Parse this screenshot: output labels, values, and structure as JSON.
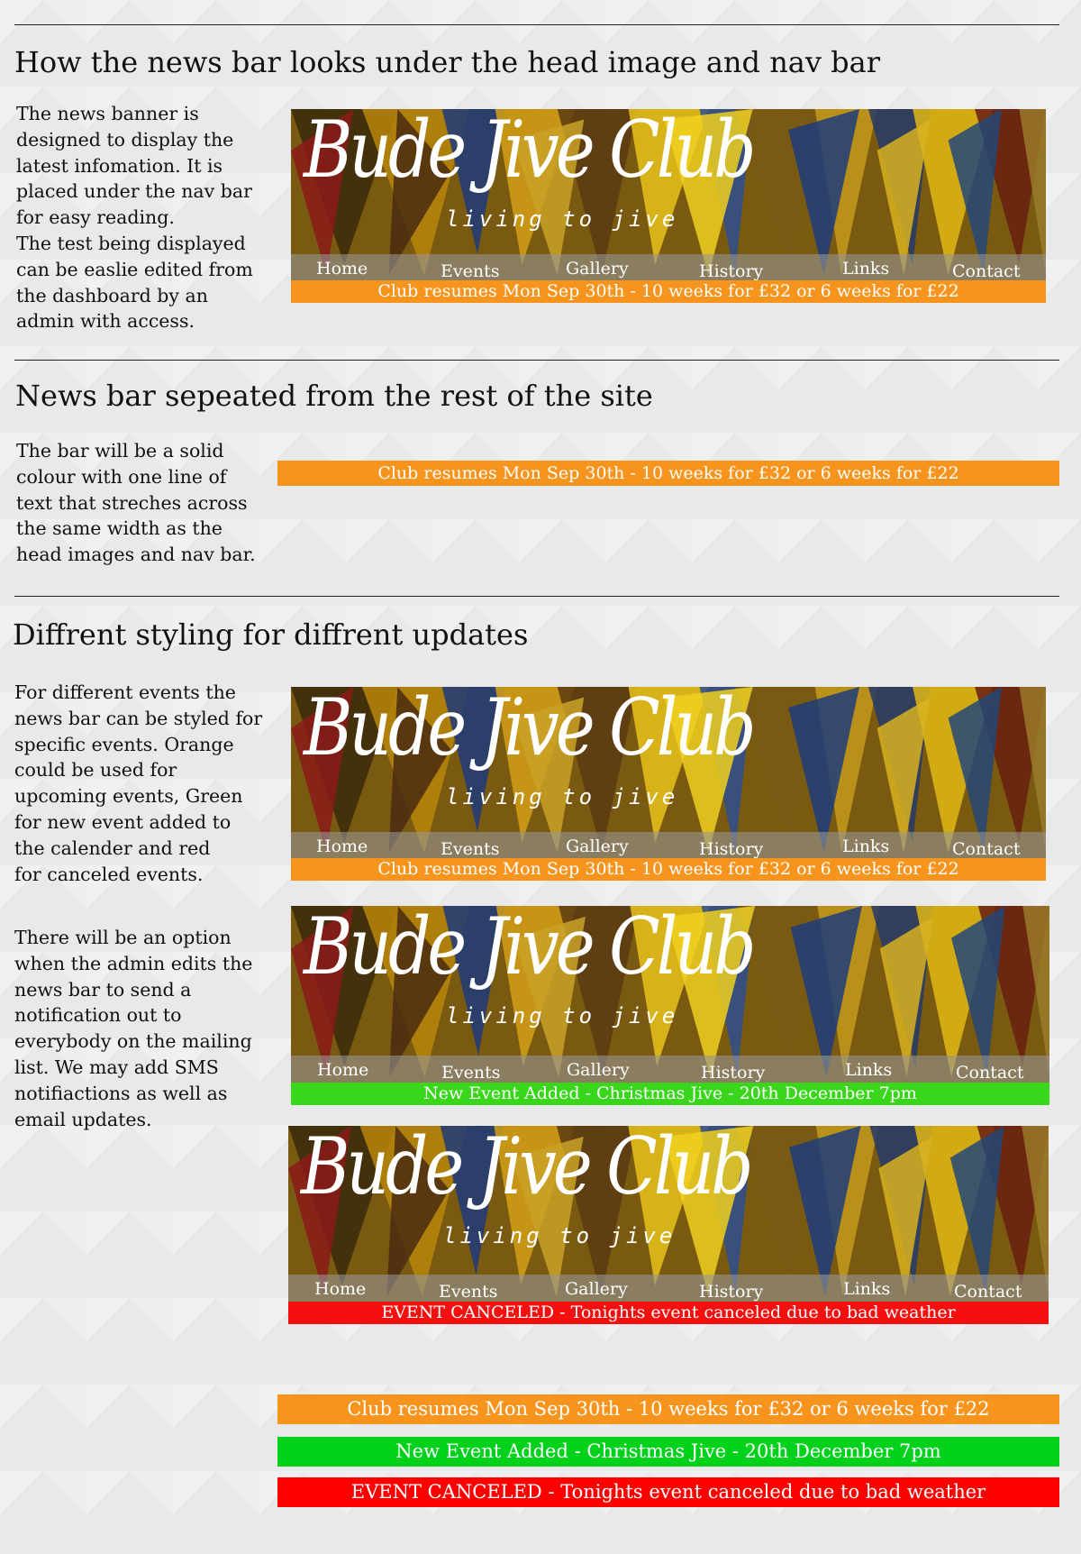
{
  "sections": [
    {
      "heading": "How the news bar looks under the head image and nav bar",
      "paragraph": [
        "The news banner is",
        "designed to display the",
        "latest infomation. It is",
        "placed under the nav bar",
        "for easy reading.",
        "The test being displayed",
        "can be easlie edited from",
        "the dashboard by an",
        "admin with access."
      ]
    },
    {
      "heading": "News bar sepeated from the rest of the site",
      "paragraph": [
        "The bar will be a solid",
        "colour with one line of",
        "text that streches across",
        "the same width as the",
        "head images and nav bar."
      ]
    },
    {
      "heading": "Diffrent styling for diffrent updates",
      "paragraph": [
        "For different events the",
        "news bar can be styled for",
        "specific events. Orange",
        "could be used for",
        "upcoming events, Green",
        "for new event added to",
        "the calender and red",
        "for canceled events."
      ],
      "paragraph2": [
        "There will be an option",
        "when the admin edits  the",
        "news bar to send a",
        "notification out to",
        "everybody on the mailing",
        "list. We may add SMS",
        "notifiactions as well as",
        "email updates."
      ]
    }
  ],
  "logo": {
    "word1": "Bude",
    "word2": "Jive",
    "word3": "Club",
    "tagline": "living to jive"
  },
  "nav": [
    "Home",
    "Events",
    "Gallery",
    "History",
    "Links",
    "Contact"
  ],
  "news": {
    "orange": "Club resumes Mon Sep 30th - 10 weeks for £32 or 6 weeks for £22",
    "green": "New Event Added - Christmas Jive - 20th December 7pm",
    "red": "EVENT CANCELED - Tonights event canceled due to bad weather"
  },
  "colors": {
    "orange": "#f7941d",
    "green": "#39d61c",
    "green_bright": "#00d21b",
    "red": "#f50f0f",
    "red_bright": "#ff0000"
  }
}
